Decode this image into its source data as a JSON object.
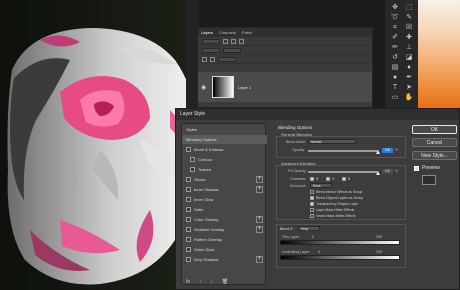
{
  "layers_panel": {
    "tabs": [
      {
        "label": "Layers",
        "active": true
      },
      {
        "label": "Channels",
        "active": false
      },
      {
        "label": "Paths",
        "active": false
      }
    ],
    "layer": {
      "name": "Layer 1",
      "visible": true
    }
  },
  "toolbar": {
    "tools": [
      "move-icon",
      "marquee-icon",
      "lasso-icon",
      "quick-select-icon",
      "crop-icon",
      "frame-icon",
      "eyedropper-icon",
      "healing-icon",
      "brush-icon",
      "stamp-icon",
      "history-brush-icon",
      "eraser-icon",
      "gradient-icon",
      "blur-icon",
      "dodge-icon",
      "pen-icon",
      "type-icon",
      "path-select-icon",
      "shape-icon",
      "hand-icon",
      "zoom-icon",
      "ellipsis-icon"
    ]
  },
  "dialog": {
    "title": "Layer Style",
    "styles_header": "Styles",
    "styles": [
      {
        "label": "Blending Options",
        "selected": true,
        "has_checkbox": false,
        "has_plus": false
      },
      {
        "label": "Bevel & Emboss",
        "selected": false,
        "has_checkbox": true,
        "has_plus": false
      },
      {
        "label": "Contour",
        "selected": false,
        "has_checkbox": true,
        "has_plus": false,
        "indent": true
      },
      {
        "label": "Texture",
        "selected": false,
        "has_checkbox": true,
        "has_plus": false,
        "indent": true
      },
      {
        "label": "Stroke",
        "selected": false,
        "has_checkbox": true,
        "has_plus": true
      },
      {
        "label": "Inner Shadow",
        "selected": false,
        "has_checkbox": true,
        "has_plus": true
      },
      {
        "label": "Inner Glow",
        "selected": false,
        "has_checkbox": true,
        "has_plus": false
      },
      {
        "label": "Satin",
        "selected": false,
        "has_checkbox": true,
        "has_plus": false
      },
      {
        "label": "Color Overlay",
        "selected": false,
        "has_checkbox": true,
        "has_plus": true
      },
      {
        "label": "Gradient Overlay",
        "selected": false,
        "has_checkbox": true,
        "has_plus": true
      },
      {
        "label": "Pattern Overlay",
        "selected": false,
        "has_checkbox": true,
        "has_plus": false
      },
      {
        "label": "Outer Glow",
        "selected": false,
        "has_checkbox": true,
        "has_plus": false
      },
      {
        "label": "Drop Shadow",
        "selected": false,
        "has_checkbox": true,
        "has_plus": true
      }
    ],
    "fx_icons": [
      "fx-icon",
      "up-arrow-icon",
      "down-arrow-icon",
      "trash-icon"
    ],
    "blending": {
      "section_title": "Blending Options",
      "general_title": "General Blending",
      "blend_mode_label": "Blend Mode:",
      "blend_mode_value": "Normal",
      "opacity_label": "Opacity:",
      "opacity_value": "100",
      "percent": "%",
      "advanced_title": "Advanced Blending",
      "fill_opacity_label": "Fill Opacity:",
      "fill_opacity_value": "100",
      "channels_label": "Channels:",
      "channel_r": "R",
      "channel_g": "G",
      "channel_b": "B",
      "knockout_label": "Knockout:",
      "knockout_value": "None",
      "checkboxes": [
        {
          "label": "Blend Interior Effects as Group",
          "checked": false
        },
        {
          "label": "Blend Clipped Layers as Group",
          "checked": true
        },
        {
          "label": "Transparency Shapes Layer",
          "checked": true
        },
        {
          "label": "Layer Mask Hides Effects",
          "checked": false
        },
        {
          "label": "Vector Mask Hides Effects",
          "checked": false
        }
      ],
      "blend_if_label": "Blend If:",
      "blend_if_value": "Gray",
      "this_layer_label": "This Layer:",
      "this_layer_low": "0",
      "this_layer_high": "255",
      "underlying_label": "Underlying Layer:",
      "underlying_low": "0",
      "underlying_high": "255"
    },
    "buttons": {
      "ok": "OK",
      "cancel": "Cancel",
      "new_style": "New Style...",
      "preview": "Preview"
    },
    "preview_checked": true
  }
}
